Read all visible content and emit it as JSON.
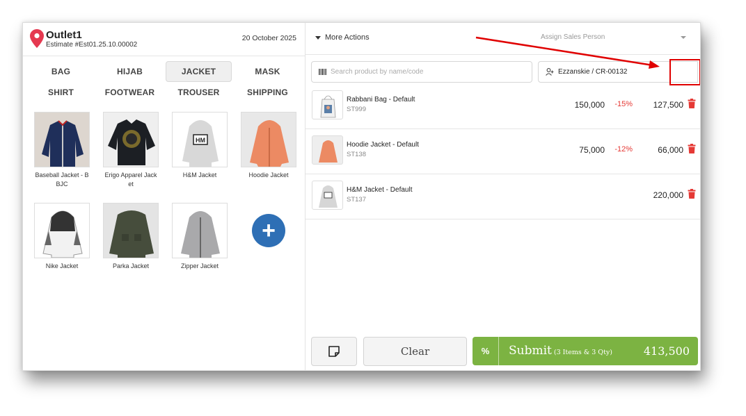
{
  "header": {
    "outlet_name": "Outlet1",
    "estimate": "Estimate #Est01.25.10.00002",
    "date": "20 October 2025"
  },
  "categories": [
    {
      "label": "BAG",
      "active": false
    },
    {
      "label": "HIJAB",
      "active": false
    },
    {
      "label": "JACKET",
      "active": true
    },
    {
      "label": "MASK",
      "active": false
    },
    {
      "label": "SHIRT",
      "active": false
    },
    {
      "label": "FOOTWEAR",
      "active": false
    },
    {
      "label": "TROUSER",
      "active": false
    },
    {
      "label": "SHIPPING",
      "active": false
    }
  ],
  "products": [
    {
      "name": "Baseball Jacket - BBJC"
    },
    {
      "name": "Erigo Apparel Jacket"
    },
    {
      "name": "H&M Jacket"
    },
    {
      "name": "Hoodie Jacket"
    },
    {
      "name": "Nike Jacket"
    },
    {
      "name": "Parka Jacket"
    },
    {
      "name": "Zipper Jacket"
    }
  ],
  "add_product_icon": "plus-icon",
  "toolbar": {
    "more_actions": "More Actions",
    "assign_sales_person": "Assign Sales Person"
  },
  "search": {
    "placeholder": "Search product by name/code"
  },
  "customer": {
    "label": "Ezzanskie / CR-00132"
  },
  "cart": [
    {
      "name": "Rabbani Bag - Default",
      "code": "ST999",
      "price": "150,000",
      "discount": "-15%",
      "total": "127,500"
    },
    {
      "name": "Hoodie Jacket - Default",
      "code": "ST138",
      "price": "75,000",
      "discount": "-12%",
      "total": "66,000"
    },
    {
      "name": "H&M Jacket - Default",
      "code": "ST137",
      "price": "",
      "discount": "",
      "total": "220,000"
    }
  ],
  "footer": {
    "clear_label": "Clear",
    "percent_label": "%",
    "submit_label": "Submit",
    "submit_summary": "(3 Items & 3 Qty)",
    "submit_total": "413,500"
  },
  "colors": {
    "accent_green": "#7cb342",
    "danger_red": "#e53935",
    "primary_blue": "#2e6fb5",
    "annotation_red": "#e00000"
  }
}
